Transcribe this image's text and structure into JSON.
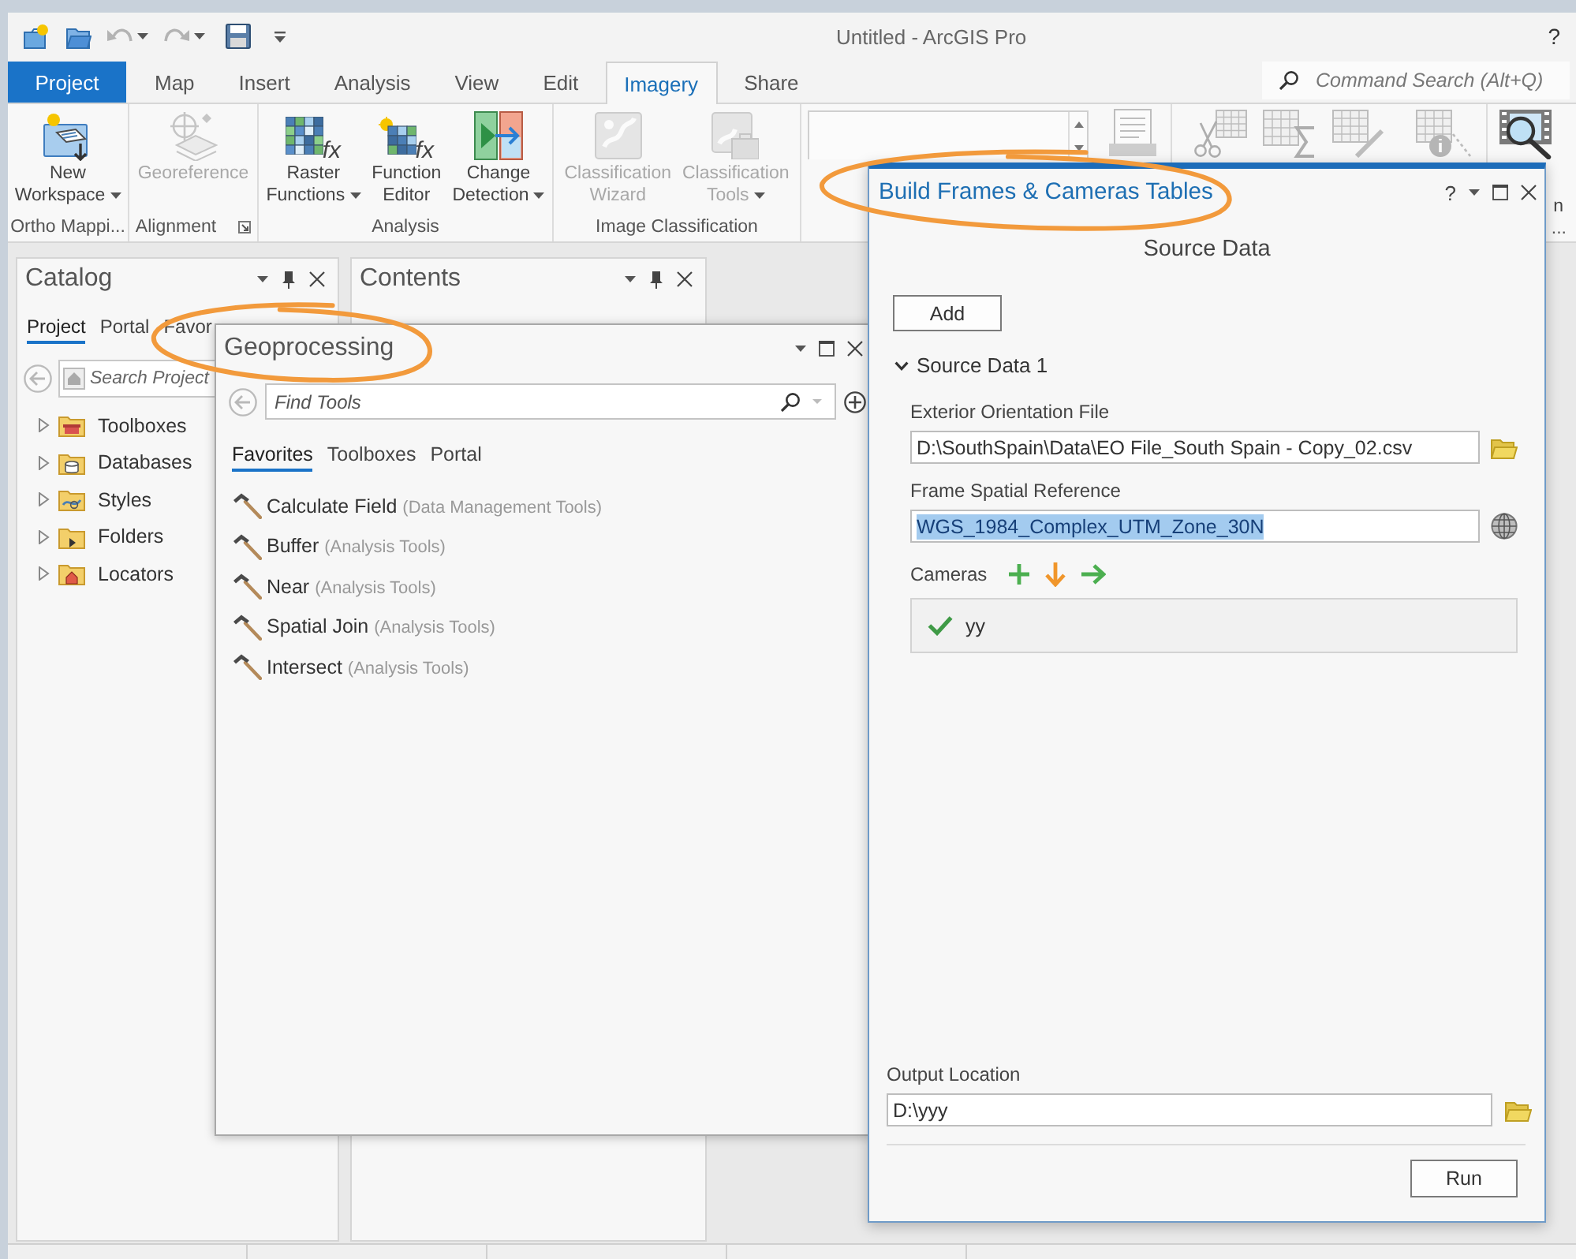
{
  "app": {
    "title": "Untitled - ArcGIS Pro",
    "help": "?",
    "quick_access": [
      {
        "disabled": false
      },
      {
        "disabled": false
      },
      {
        "disabled": true,
        "dropdown": true
      },
      {
        "disabled": true,
        "dropdown": true
      },
      {
        "disabled": false
      }
    ]
  },
  "ribbon_tabs": [
    {
      "label": "Project",
      "kind": "backstage",
      "selected": false
    },
    {
      "label": "Map",
      "kind": "tab",
      "selected": false
    },
    {
      "label": "Insert",
      "kind": "tab",
      "selected": false
    },
    {
      "label": "Analysis",
      "kind": "tab",
      "selected": false
    },
    {
      "label": "View",
      "kind": "tab",
      "selected": false
    },
    {
      "label": "Edit",
      "kind": "tab",
      "selected": false
    },
    {
      "label": "Imagery",
      "kind": "tab",
      "selected": true
    },
    {
      "label": "Share",
      "kind": "tab",
      "selected": false
    }
  ],
  "command_search": {
    "placeholder": "Command Search (Alt+Q)"
  },
  "ribbon_groups": [
    {
      "label": "Ortho Mappi...",
      "buttons": [
        {
          "label": "New Workspace",
          "dropdown": true,
          "disabled": false
        }
      ]
    },
    {
      "label": "Alignment",
      "launcher": true,
      "buttons": [
        {
          "label": "Georeference",
          "disabled": true
        }
      ]
    },
    {
      "label": "Analysis",
      "buttons": [
        {
          "label": "Raster Functions",
          "symbol": "fx",
          "dropdown": true,
          "disabled": false
        },
        {
          "label": "Function Editor",
          "symbol": "fx",
          "disabled": false
        },
        {
          "label": "Change Detection",
          "dropdown": true,
          "disabled": false
        }
      ]
    },
    {
      "label": "Image Classification",
      "buttons": [
        {
          "label": "Classification Wizard",
          "disabled": true
        },
        {
          "label": "Classification Tools",
          "dropdown": true,
          "disabled": true
        }
      ]
    }
  ],
  "ribbon_more": {
    "tools": [
      {
        "disabled": true
      },
      {
        "disabled": true
      },
      {
        "disabled": true
      },
      {
        "disabled": true
      },
      {
        "disabled": true
      },
      {
        "label": "n",
        "disabled": false
      }
    ],
    "group_label": "..."
  },
  "catalog": {
    "title": "Catalog",
    "tabs": [
      {
        "label": "Project",
        "selected": true
      },
      {
        "label": "Portal",
        "selected": false
      },
      {
        "label": "Favor",
        "selected": false
      }
    ],
    "search": {
      "placeholder": "Search Project"
    },
    "items": [
      {
        "label": "Toolboxes",
        "expanded": false
      },
      {
        "label": "Databases",
        "expanded": false
      },
      {
        "label": "Styles",
        "expanded": false
      },
      {
        "label": "Folders",
        "expanded": false
      },
      {
        "label": "Locators",
        "expanded": false
      }
    ]
  },
  "contents": {
    "title": "Contents"
  },
  "geoprocessing": {
    "title": "Geoprocessing",
    "title_circled": true,
    "search": {
      "placeholder": "Find Tools"
    },
    "tabs": [
      {
        "label": "Favorites",
        "selected": true
      },
      {
        "label": "Toolboxes",
        "selected": false
      },
      {
        "label": "Portal",
        "selected": false
      }
    ],
    "tools": [
      {
        "name": "Calculate Field",
        "category": "(Data Management Tools)"
      },
      {
        "name": "Buffer",
        "category": "(Analysis Tools)"
      },
      {
        "name": "Near",
        "category": "(Analysis Tools)"
      },
      {
        "name": "Spatial Join",
        "category": "(Analysis Tools)"
      },
      {
        "name": "Intersect",
        "category": "(Analysis Tools)"
      }
    ]
  },
  "dialog": {
    "title": "Build Frames & Cameras Tables",
    "title_circled": true,
    "help": "?",
    "heading": "Source Data",
    "add_button": "Add",
    "section": {
      "title": "Source Data 1",
      "expanded": true,
      "fields": [
        {
          "label": "Exterior Orientation File",
          "value": "D:\\SouthSpain\\Data\\EO File_South Spain - Copy_02.csv",
          "kind": "file",
          "text_selected": false
        },
        {
          "label": "Frame Spatial Reference",
          "value": "WGS_1984_Complex_UTM_Zone_30N",
          "kind": "coordinate",
          "text_selected": true
        }
      ],
      "cameras": {
        "label": "Cameras",
        "items": [
          {
            "name": "yy",
            "valid": true
          }
        ]
      }
    },
    "output": {
      "label": "Output Location",
      "value": "D:\\yyy",
      "kind": "file"
    },
    "run_button": "Run"
  }
}
